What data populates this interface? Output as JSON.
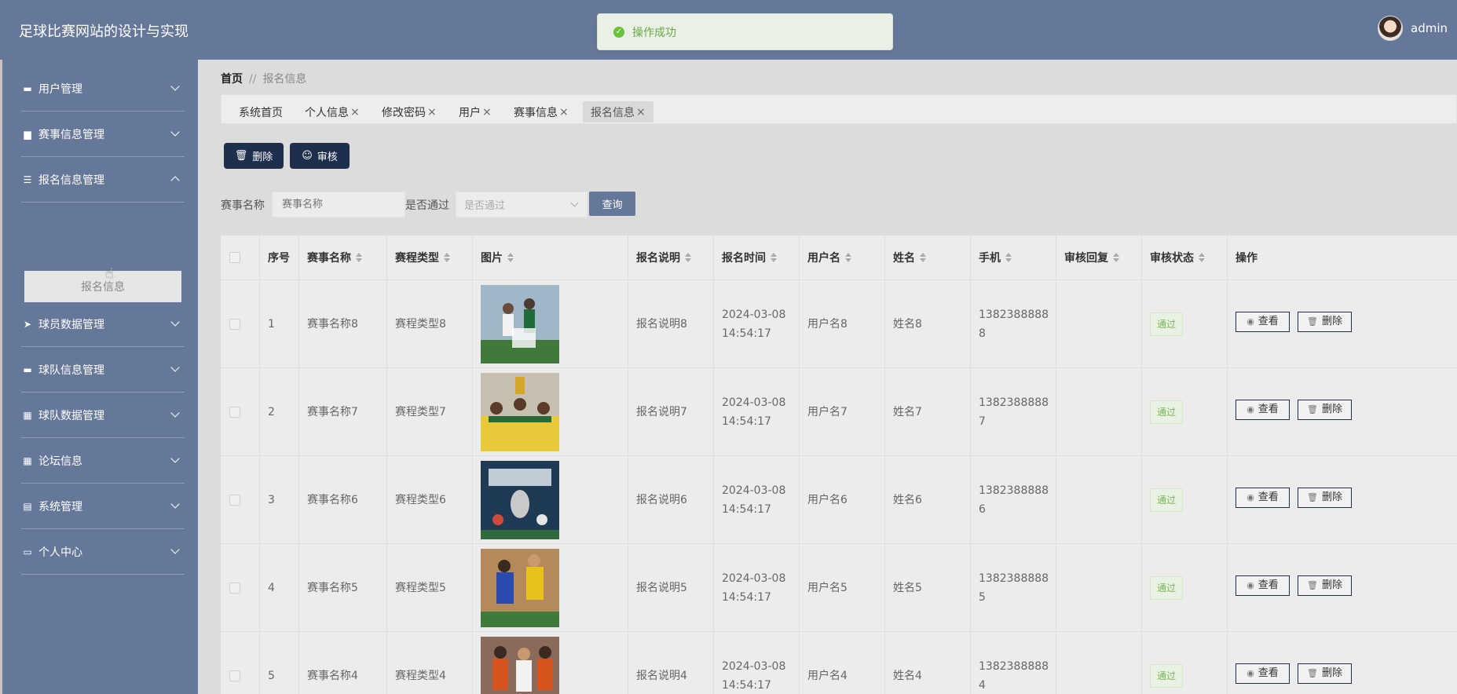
{
  "header": {
    "title": "足球比赛网站的设计与实现",
    "username": "admin"
  },
  "toast": {
    "message": "操作成功"
  },
  "sidebar": {
    "items": [
      {
        "label": "用户管理",
        "icon": "chat-icon"
      },
      {
        "label": "赛事信息管理",
        "icon": "briefcase-icon"
      },
      {
        "label": "报名信息管理",
        "icon": "list-icon",
        "expanded": true
      },
      {
        "label": "球员数据管理",
        "icon": "send-icon"
      },
      {
        "label": "球队信息管理",
        "icon": "ticket-icon"
      },
      {
        "label": "球队数据管理",
        "icon": "grid-icon"
      },
      {
        "label": "论坛信息",
        "icon": "grid-icon"
      },
      {
        "label": "系统管理",
        "icon": "clipboard-icon"
      },
      {
        "label": "个人中心",
        "icon": "card-icon"
      }
    ],
    "submenu_active": "报名信息"
  },
  "breadcrumb": {
    "home": "首页",
    "separator": "//",
    "current": "报名信息"
  },
  "tabs": [
    {
      "label": "系统首页",
      "closable": false
    },
    {
      "label": "个人信息",
      "closable": true
    },
    {
      "label": "修改密码",
      "closable": true
    },
    {
      "label": "用户",
      "closable": true
    },
    {
      "label": "赛事信息",
      "closable": true
    },
    {
      "label": "报名信息",
      "closable": true,
      "active": true
    }
  ],
  "tab_close": "×",
  "toolbar": {
    "delete_label": "删除",
    "audit_label": "审核"
  },
  "search": {
    "name_label": "赛事名称",
    "name_placeholder": "赛事名称",
    "pass_label": "是否通过",
    "pass_placeholder": "是否通过",
    "query_label": "查询"
  },
  "table": {
    "columns": [
      "序号",
      "赛事名称",
      "赛程类型",
      "图片",
      "报名说明",
      "报名时间",
      "用户名",
      "姓名",
      "手机",
      "审核回复",
      "审核状态",
      "操作"
    ],
    "view_label": "查看",
    "delete_label": "删除",
    "rows": [
      {
        "no": "1",
        "name": "赛事名称8",
        "type": "赛程类型8",
        "desc": "报名说明8",
        "date": "2024-03-08",
        "time": "14:54:17",
        "user": "用户名8",
        "real": "姓名8",
        "phone1": "1382388888",
        "phone2": "8",
        "reply": "",
        "status": "通过"
      },
      {
        "no": "2",
        "name": "赛事名称7",
        "type": "赛程类型7",
        "desc": "报名说明7",
        "date": "2024-03-08",
        "time": "14:54:17",
        "user": "用户名7",
        "real": "姓名7",
        "phone1": "1382388888",
        "phone2": "7",
        "reply": "",
        "status": "通过"
      },
      {
        "no": "3",
        "name": "赛事名称6",
        "type": "赛程类型6",
        "desc": "报名说明6",
        "date": "2024-03-08",
        "time": "14:54:17",
        "user": "用户名6",
        "real": "姓名6",
        "phone1": "1382388888",
        "phone2": "6",
        "reply": "",
        "status": "通过"
      },
      {
        "no": "4",
        "name": "赛事名称5",
        "type": "赛程类型5",
        "desc": "报名说明5",
        "date": "2024-03-08",
        "time": "14:54:17",
        "user": "用户名5",
        "real": "姓名5",
        "phone1": "1382388888",
        "phone2": "5",
        "reply": "",
        "status": "通过"
      },
      {
        "no": "5",
        "name": "赛事名称4",
        "type": "赛程类型4",
        "desc": "报名说明4",
        "date": "2024-03-08",
        "time": "14:54:17",
        "user": "用户名4",
        "real": "姓名4",
        "phone1": "1382388888",
        "phone2": "4",
        "reply": "",
        "status": "通过"
      }
    ]
  }
}
